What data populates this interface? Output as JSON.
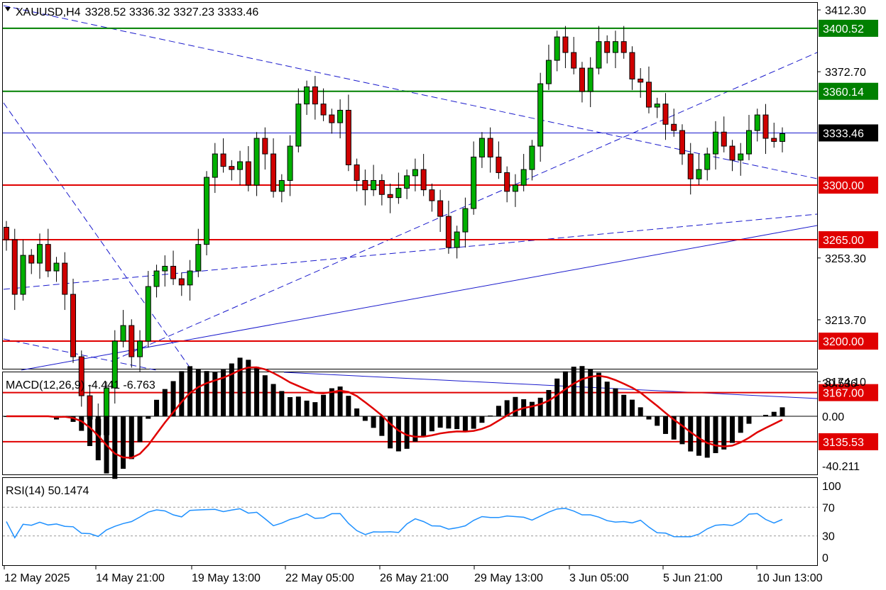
{
  "header": {
    "symbol": "XAUUSD,H4",
    "ohlc": "3328.52 3336.32 3327.23 3333.46"
  },
  "price_axis": {
    "ticks": [
      "3412.30",
      "3372.70",
      "3253.30",
      "3213.70",
      "3174.10"
    ]
  },
  "levels": [
    {
      "value": 3400.52,
      "label": "3400.52",
      "color": "#008000",
      "kind": "resistance"
    },
    {
      "value": 3360.14,
      "label": "3360.14",
      "color": "#008000",
      "kind": "resistance"
    },
    {
      "value": 3333.46,
      "label": "3333.46",
      "color": "#000000",
      "kind": "current"
    },
    {
      "value": 3300.0,
      "label": "3300.00",
      "color": "#e00000",
      "kind": "support"
    },
    {
      "value": 3265.0,
      "label": "3265.00",
      "color": "#e00000",
      "kind": "support"
    },
    {
      "value": 3200.0,
      "label": "3200.00",
      "color": "#e00000",
      "kind": "support"
    },
    {
      "value": 3167.0,
      "label": "3167.00",
      "color": "#e00000",
      "kind": "support"
    },
    {
      "value": 3135.53,
      "label": "3135.53",
      "color": "#e00000",
      "kind": "support"
    }
  ],
  "time_axis": [
    "12 May 2025",
    "14 May 21:00",
    "19 May 13:00",
    "22 May 05:00",
    "26 May 21:00",
    "29 May 13:00",
    "3 Jun 05:00",
    "5 Jun 21:00",
    "10 Jun 13:00"
  ],
  "macd": {
    "title": "MACD(12,26,9) -4.441 -6.763",
    "ticks": [
      "30.536",
      "0.00",
      "-40.211"
    ]
  },
  "rsi": {
    "title": "RSI(14) 50.1474",
    "ticks": [
      "100",
      "70",
      "30",
      "0"
    ]
  },
  "colors": {
    "bull": "#00b000",
    "bear": "#d00000",
    "trend": "#1a1acc",
    "signal": "#e00000"
  },
  "chart_data": {
    "type": "candlestick",
    "series_points": [
      3265,
      3230,
      3255,
      3250,
      3262,
      3245,
      3250,
      3230,
      3190,
      3165,
      3150,
      3140,
      3170,
      3200,
      3210,
      3190,
      3200,
      3235,
      3245,
      3248,
      3240,
      3236,
      3245,
      3262,
      3305,
      3320,
      3312,
      3310,
      3315,
      3300,
      3330,
      3320,
      3296,
      3303,
      3325,
      3352,
      3363,
      3352,
      3345,
      3340,
      3348,
      3313,
      3303,
      3297,
      3303,
      3294,
      3292,
      3298,
      3306,
      3310,
      3297,
      3290,
      3280,
      3260,
      3270,
      3285,
      3318,
      3330,
      3318,
      3308,
      3296,
      3300,
      3310,
      3325,
      3365,
      3380,
      3395,
      3385,
      3375,
      3360,
      3375,
      3392,
      3385,
      3392,
      3385,
      3368,
      3366,
      3350,
      3352,
      3339,
      3335,
      3320,
      3304,
      3310,
      3320,
      3334,
      3325,
      3316,
      3320,
      3335,
      3345,
      3330,
      3328,
      3333
    ]
  }
}
